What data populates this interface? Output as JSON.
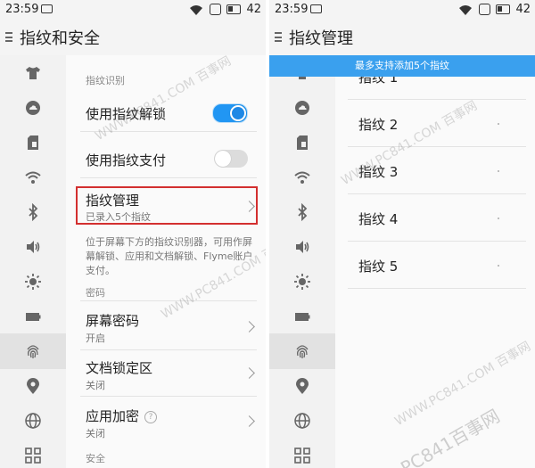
{
  "left_screen": {
    "status": {
      "time": "23:59",
      "battery": "42"
    },
    "title": "指纹和安全",
    "section_fingerprint": "指纹识别",
    "unlock_label": "使用指纹解锁",
    "unlock_toggle": "on",
    "pay_label": "使用指纹支付",
    "pay_toggle": "off",
    "manage_label": "指纹管理",
    "manage_sub": "已录入5个指纹",
    "description": "位于屏幕下方的指纹识别器，可用作屏幕解锁、应用和文档解锁、Flyme账户支付。",
    "section_password": "密码",
    "screen_password_label": "屏幕密码",
    "screen_password_sub": "开启",
    "doc_lock_label": "文档锁定区",
    "doc_lock_sub": "关闭",
    "app_encrypt_label": "应用加密",
    "app_encrypt_sub": "关闭",
    "help_glyph": "?",
    "section_security": "安全",
    "watermark": "WWW.PC841.COM 百事网"
  },
  "right_screen": {
    "status": {
      "time": "23:59",
      "battery": "42"
    },
    "title": "指纹管理",
    "banner": "最多支持添加5个指纹",
    "fingerprints": [
      "指纹 1",
      "指纹 2",
      "指纹 3",
      "指纹 4",
      "指纹 5"
    ],
    "watermark": "WWW.PC841.COM 百事网",
    "watermark_logo": "PC841百事网"
  },
  "icons": [
    "shirt-icon",
    "cloud-icon",
    "sim-icon",
    "wifi-icon",
    "bluetooth-icon",
    "volume-icon",
    "brightness-icon",
    "battery-icon",
    "fingerprint-icon",
    "location-icon",
    "globe-icon",
    "apps-icon"
  ],
  "colors": {
    "accent": "#2196f3",
    "banner": "#3aa0ee",
    "highlight": "#d32f2f"
  }
}
